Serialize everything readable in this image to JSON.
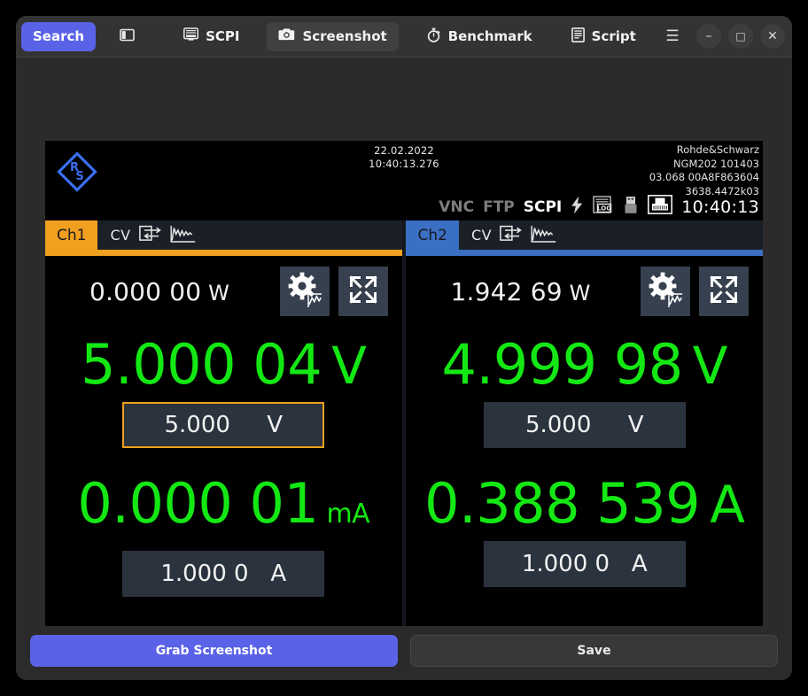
{
  "toolbar": {
    "search_label": "Search",
    "sidebar_toggle_icon": "panel-left-icon",
    "scpi_label": "SCPI",
    "scpi_icon": "monitor-icon",
    "screenshot_label": "Screenshot",
    "screenshot_icon": "camera-icon",
    "benchmark_label": "Benchmark",
    "benchmark_icon": "stopwatch-icon",
    "script_label": "Script",
    "script_icon": "document-icon",
    "menu_icon": "hamburger-icon",
    "minimize_icon": "minimize-icon",
    "maximize_icon": "maximize-icon",
    "close_icon": "close-icon",
    "minimize_glyph": "–",
    "maximize_glyph": "□",
    "close_glyph": "✕",
    "menu_glyph": "☰",
    "accent_color": "#5a62e8"
  },
  "instrument": {
    "date": "22.02.2022",
    "time": "10:40:13.276",
    "vendor": "Rohde&Schwarz",
    "model": "NGM202 101403",
    "firmware": "03.068 00A8F863604",
    "serial": "3638.4472k03",
    "logo_text_top": "R",
    "logo_text_bottom": "S",
    "status": {
      "vnc": "VNC",
      "ftp": "FTP",
      "scpi": "SCPI",
      "bolt_icon": "lightning-icon",
      "log_icon": "log-icon",
      "usb_icon": "usb-icon",
      "lan_icon": "lan-icon",
      "clock": "10:40:13"
    },
    "channels": [
      {
        "tab_label": "Ch1",
        "tab_color": "#f0a01e",
        "mode": "CV",
        "io_icon": "io-arrows-icon",
        "graph_icon": "waveform-icon",
        "settings_icon": "gear-graph-icon",
        "expand_icon": "expand-arrows-icon",
        "power_value": "0.000 00",
        "power_unit": "W",
        "voltage_value": "5.000 04",
        "voltage_unit": "V",
        "voltage_set": "5.000     V",
        "voltage_set_selected": true,
        "current_value": "0.000 01",
        "current_unit": "mA",
        "current_unit_small": true,
        "current_set": "1.000 0   A",
        "current_set_selected": false,
        "reading_color": "#14e814"
      },
      {
        "tab_label": "Ch2",
        "tab_color": "#3a6fc4",
        "mode": "CV",
        "io_icon": "io-arrows-icon",
        "graph_icon": "waveform-icon",
        "settings_icon": "gear-graph-icon",
        "expand_icon": "expand-arrows-icon",
        "power_value": "1.942 69",
        "power_unit": "W",
        "voltage_value": "4.999 98",
        "voltage_unit": "V",
        "voltage_set": "5.000     V",
        "voltage_set_selected": false,
        "current_value": "0.388 539",
        "current_unit": "A",
        "current_unit_small": false,
        "current_set": "1.000 0   A",
        "current_set_selected": false,
        "reading_color": "#14e814"
      }
    ]
  },
  "footer": {
    "grab_label": "Grab Screenshot",
    "save_label": "Save"
  }
}
